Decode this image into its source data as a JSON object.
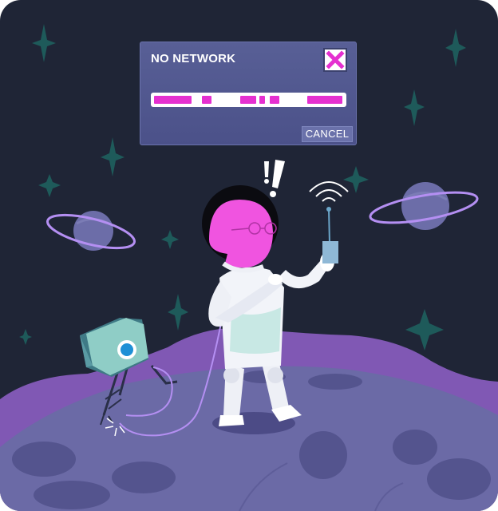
{
  "dialog": {
    "title": "NO NETWORK",
    "cancel_label": "CANCEL",
    "close_icon": "close-icon"
  },
  "colors": {
    "background": "#1f2536",
    "accent_magenta": "#e530d0",
    "teal_sparkle": "#1e5a5a",
    "planet_purple": "#6c6da8",
    "ring_lilac": "#b48ff2"
  }
}
